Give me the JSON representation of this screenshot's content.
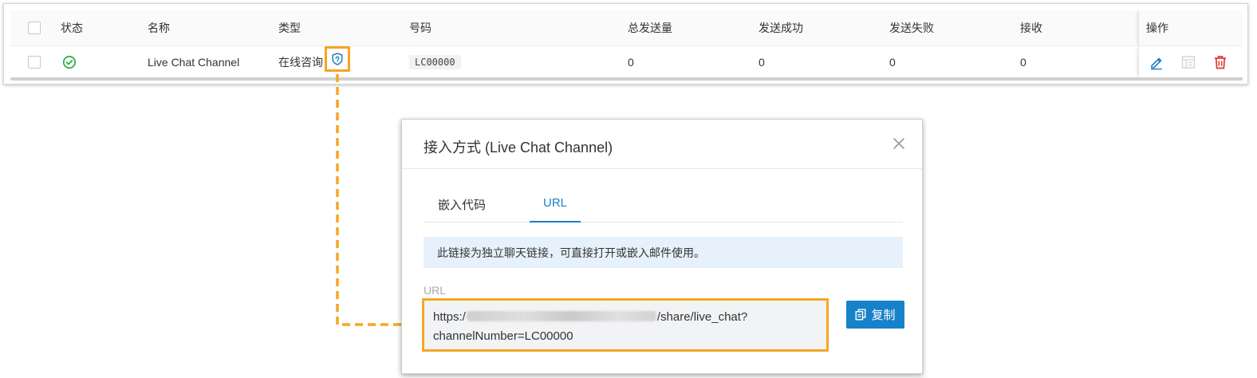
{
  "table": {
    "headers": {
      "status": "状态",
      "name": "名称",
      "type": "类型",
      "number": "号码",
      "total_sent": "总发送量",
      "sent_success": "发送成功",
      "sent_failed": "发送失败",
      "received": "接收",
      "actions": "操作"
    },
    "rows": [
      {
        "status": "enabled",
        "name": "Live Chat Channel",
        "type": "在线咨询",
        "number": "LC00000",
        "total_sent": "0",
        "sent_success": "0",
        "sent_failed": "0",
        "received": "0"
      }
    ]
  },
  "dialog": {
    "title": "接入方式 (Live Chat Channel)",
    "tabs": [
      {
        "label": "嵌入代码",
        "active": false
      },
      {
        "label": "URL",
        "active": true
      }
    ],
    "notice": "此链接为独立聊天链接，可直接打开或嵌入邮件使用。",
    "url_label": "URL",
    "url_prefix": "https:/",
    "url_suffix": "/share/live_chat?",
    "url_line2": "channelNumber=LC00000",
    "copy_label": "复制"
  },
  "colors": {
    "accent_blue": "#1e7ec8",
    "button_blue": "#1781c9",
    "highlight_orange": "#f5a623",
    "status_green": "#2bb34a",
    "delete_red": "#e0382c",
    "notice_bg": "#e6f1fb"
  },
  "icons": {
    "status": "check-circle-icon",
    "type": "shield-icon",
    "edit": "edit-pencil-icon",
    "details": "table-details-icon",
    "delete": "trash-icon",
    "close": "close-icon",
    "copy": "copy-icon"
  }
}
